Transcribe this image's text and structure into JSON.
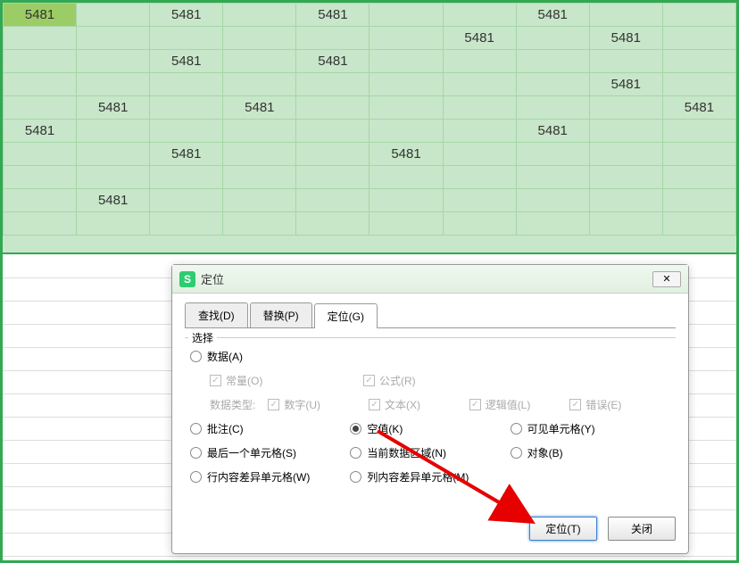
{
  "sheet": {
    "value": "5481",
    "cells": [
      [
        0,
        0
      ],
      [
        0,
        2
      ],
      [
        0,
        4
      ],
      [
        0,
        7
      ],
      [
        1,
        6
      ],
      [
        1,
        8
      ],
      [
        2,
        2
      ],
      [
        2,
        4
      ],
      [
        3,
        8
      ],
      [
        4,
        1
      ],
      [
        4,
        3
      ],
      [
        4,
        9
      ],
      [
        5,
        0
      ],
      [
        5,
        7
      ],
      [
        6,
        2
      ],
      [
        6,
        5
      ],
      [
        8,
        1
      ]
    ]
  },
  "dialog": {
    "title": "定位",
    "tabs": {
      "find": "查找(D)",
      "replace": "替换(P)",
      "goto": "定位(G)"
    },
    "section_label": "选择",
    "options": {
      "data": "数据(A)",
      "const": "常量(O)",
      "formula": "公式(R)",
      "datatype_label": "数据类型:",
      "number": "数字(U)",
      "text": "文本(X)",
      "logical": "逻辑值(L)",
      "error": "错误(E)",
      "comments": "批注(C)",
      "blanks": "空值(K)",
      "visible": "可见单元格(Y)",
      "lastcell": "最后一个单元格(S)",
      "current_region": "当前数据区域(N)",
      "objects": "对象(B)",
      "row_diff": "行内容差异单元格(W)",
      "col_diff": "列内容差异单元格(M)"
    },
    "buttons": {
      "goto": "定位(T)",
      "close": "关闭"
    }
  }
}
